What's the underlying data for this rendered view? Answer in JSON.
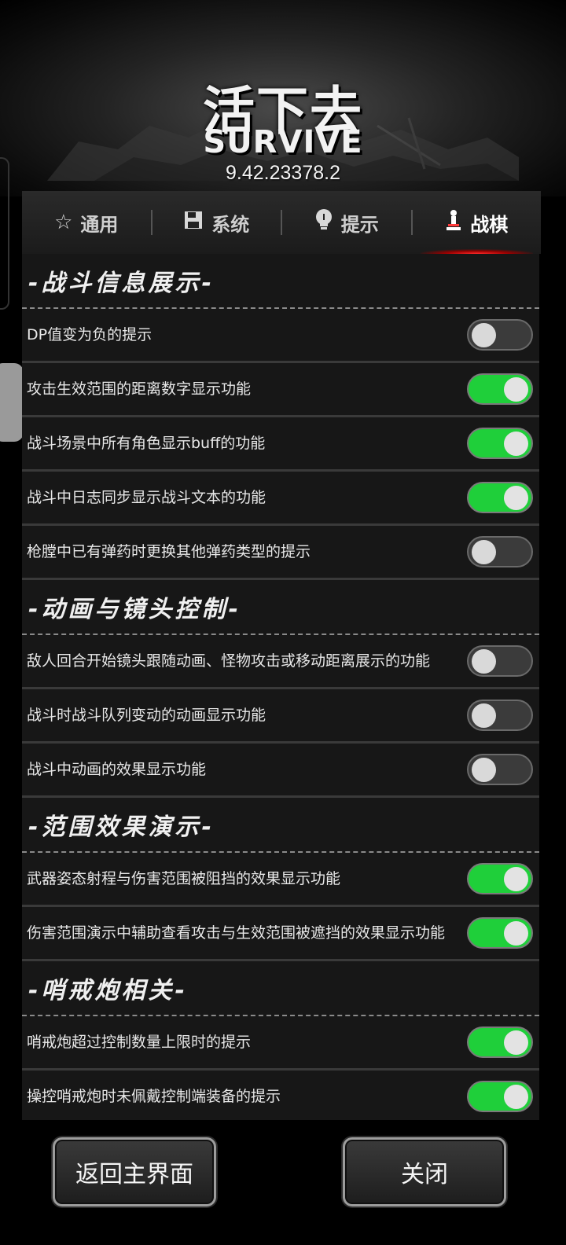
{
  "header": {
    "logo_cn": "活下去",
    "logo_en": "SURVIVE",
    "version": "9.42.23378.2"
  },
  "tabs": [
    {
      "label": "通用",
      "icon": "star-icon",
      "active": false
    },
    {
      "label": "系统",
      "icon": "save-disk-icon",
      "active": false
    },
    {
      "label": "提示",
      "icon": "lightbulb-icon",
      "active": false
    },
    {
      "label": "战棋",
      "icon": "chess-pawn-icon",
      "active": true
    }
  ],
  "sections": [
    {
      "title": "-战斗信息展示-",
      "items": [
        {
          "label": "DP值变为负的提示",
          "on": false
        },
        {
          "label": "攻击生效范围的距离数字显示功能",
          "on": true
        },
        {
          "label": "战斗场景中所有角色显示buff的功能",
          "on": true
        },
        {
          "label": "战斗中日志同步显示战斗文本的功能",
          "on": true
        },
        {
          "label": "枪膛中已有弹药时更换其他弹药类型的提示",
          "on": false
        }
      ]
    },
    {
      "title": "-动画与镜头控制-",
      "items": [
        {
          "label": "敌人回合开始镜头跟随动画、怪物攻击或移动距离展示的功能",
          "on": false
        },
        {
          "label": "战斗时战斗队列变动的动画显示功能",
          "on": false
        },
        {
          "label": "战斗中动画的效果显示功能",
          "on": false
        }
      ]
    },
    {
      "title": "-范围效果演示-",
      "items": [
        {
          "label": "武器姿态射程与伤害范围被阻挡的效果显示功能",
          "on": true
        },
        {
          "label": "伤害范围演示中辅助查看攻击与生效范围被遮挡的效果显示功能",
          "on": true
        }
      ]
    },
    {
      "title": "-哨戒炮相关-",
      "items": [
        {
          "label": "哨戒炮超过控制数量上限时的提示",
          "on": true
        },
        {
          "label": "操控哨戒炮时未佩戴控制端装备的提示",
          "on": true
        }
      ]
    }
  ],
  "buttons": {
    "home": "返回主界面",
    "close": "关闭"
  },
  "colors": {
    "toggle_on": "#1fcf3a",
    "toggle_off": "#3b3b3b",
    "tab_accent": "#ff2a2a"
  }
}
